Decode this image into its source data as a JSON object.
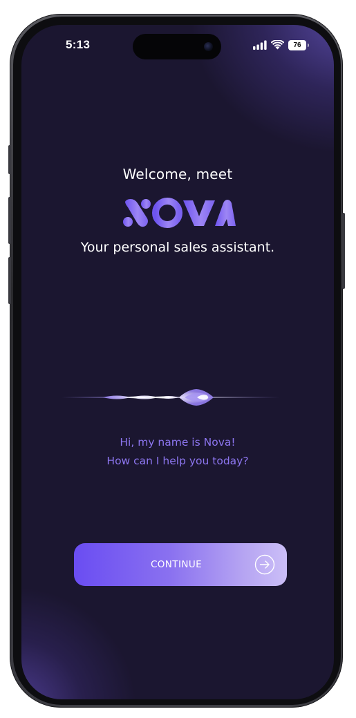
{
  "status_bar": {
    "time": "5:13",
    "battery": "76",
    "icons": [
      "signal-icon",
      "wifi-icon",
      "battery-icon"
    ]
  },
  "welcome": {
    "heading": "Welcome, meet",
    "logo_text": "NOVA",
    "tagline": "Your personal sales assistant."
  },
  "assistant": {
    "waveform_icon": "voice-waveform-icon",
    "greeting_line1": "Hi, my name is Nova!",
    "greeting_line2": "How can I help you today?"
  },
  "continue_button": {
    "label": "CONTINUE",
    "icon": "arrow-right-circle-icon"
  },
  "colors": {
    "background": "#1b1630",
    "accent": "#6a4df2",
    "greeting_text": "#8d76f0",
    "button_gradient_end": "#cbbef7"
  }
}
